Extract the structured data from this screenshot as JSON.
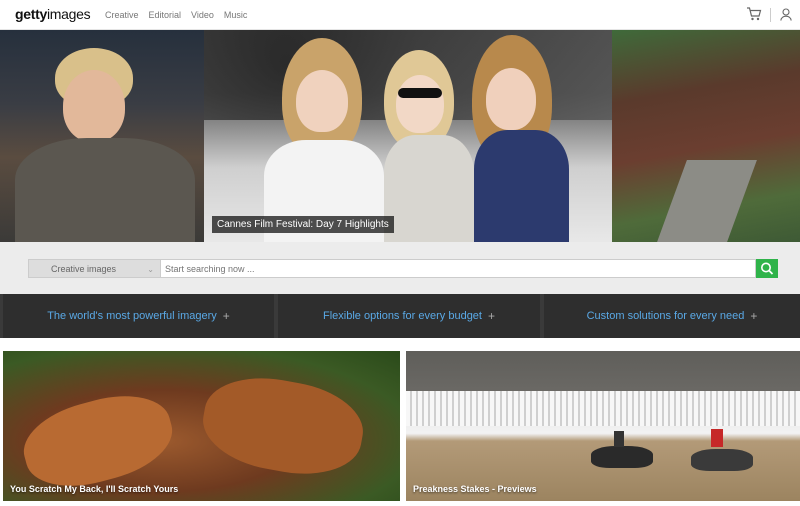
{
  "brand": {
    "logo_bold": "getty",
    "logo_light": "images"
  },
  "nav": {
    "items": [
      "Creative",
      "Editorial",
      "Video",
      "Music"
    ]
  },
  "header_icons": [
    "cart-icon",
    "user-icon"
  ],
  "hero": {
    "caption": "Cannes Film Festival: Day 7 Highlights"
  },
  "search": {
    "category": "Creative images",
    "placeholder": "Start searching now ...",
    "button_icon": "search-icon"
  },
  "promos": [
    {
      "label": "The world's most powerful imagery",
      "icon": "plus-icon"
    },
    {
      "label": "Flexible options for every budget",
      "icon": "plus-icon"
    },
    {
      "label": "Custom solutions for every need",
      "icon": "plus-icon"
    }
  ],
  "tiles": [
    {
      "title": "You Scratch My Back, I'll Scratch Yours"
    },
    {
      "title": "Preakness Stakes - Previews"
    }
  ],
  "colors": {
    "accent_green": "#2fb34a",
    "promo_text": "#5aa9e6",
    "promo_bg": "#2e2e2e"
  }
}
